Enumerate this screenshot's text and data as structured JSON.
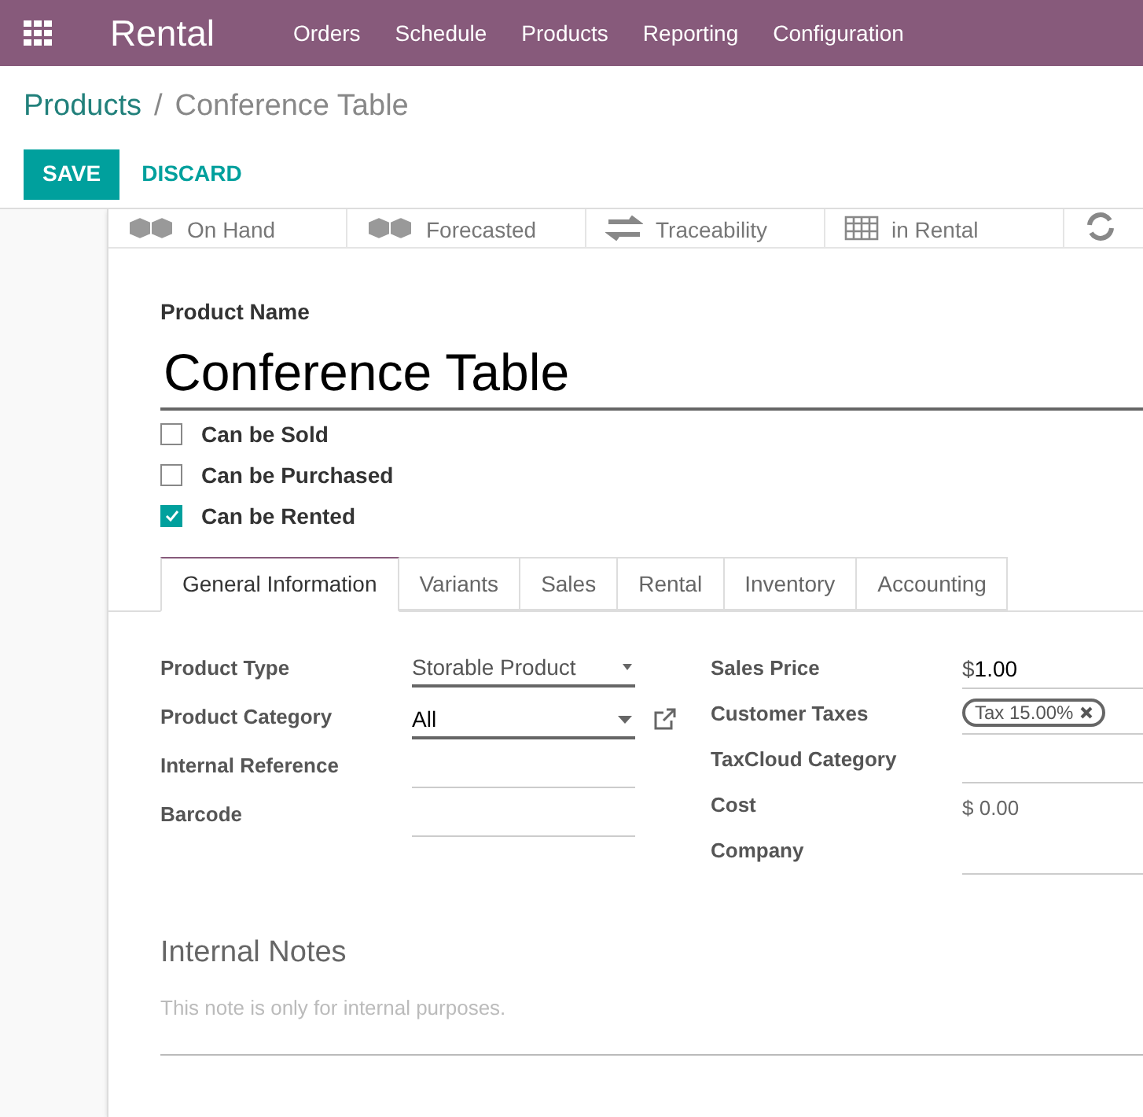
{
  "navbar": {
    "app": "Rental",
    "menu": [
      "Orders",
      "Schedule",
      "Products",
      "Reporting",
      "Configuration"
    ]
  },
  "breadcrumb": {
    "parent": "Products",
    "separator": "/",
    "current": "Conference Table"
  },
  "buttons": {
    "save": "SAVE",
    "discard": "DISCARD"
  },
  "stat_buttons": [
    {
      "kind": "cubes",
      "label": "On Hand"
    },
    {
      "kind": "cubes",
      "label": "Forecasted"
    },
    {
      "kind": "arrows",
      "label": "Traceability"
    },
    {
      "kind": "grid",
      "label": "in Rental"
    },
    {
      "kind": "refresh"
    }
  ],
  "product_name": {
    "label": "Product Name",
    "value": "Conference Table"
  },
  "options": [
    {
      "label": "Can be Sold",
      "checked": false
    },
    {
      "label": "Can be Purchased",
      "checked": false
    },
    {
      "label": "Can be Rented",
      "checked": true
    }
  ],
  "tabs": [
    {
      "label": "General Information",
      "selected": true
    },
    {
      "label": "Variants",
      "selected": false
    },
    {
      "label": "Sales",
      "selected": false
    },
    {
      "label": "Rental",
      "selected": false
    },
    {
      "label": "Inventory",
      "selected": false
    },
    {
      "label": "Accounting",
      "selected": false
    }
  ],
  "left_fields": [
    {
      "label": "Product Type",
      "kind": "select",
      "value": "Storable Product"
    },
    {
      "label": "Product Category",
      "kind": "many2one",
      "value": "All"
    },
    {
      "label": "Internal Reference",
      "kind": "text"
    },
    {
      "label": "Barcode",
      "kind": "text"
    }
  ],
  "right_fields": [
    {
      "label": "Sales Price",
      "kind": "price",
      "currency": "$",
      "value": "1.00"
    },
    {
      "label": "Customer Taxes",
      "kind": "tags",
      "tags": [
        "Tax 15.00%"
      ]
    },
    {
      "label": "TaxCloud Category",
      "kind": "text"
    },
    {
      "label": "Cost",
      "kind": "readonly",
      "value": "$ 0.00"
    },
    {
      "label": "Company",
      "kind": "text"
    }
  ],
  "internal_notes": {
    "title": "Internal Notes",
    "placeholder": "This note is only for internal purposes."
  }
}
